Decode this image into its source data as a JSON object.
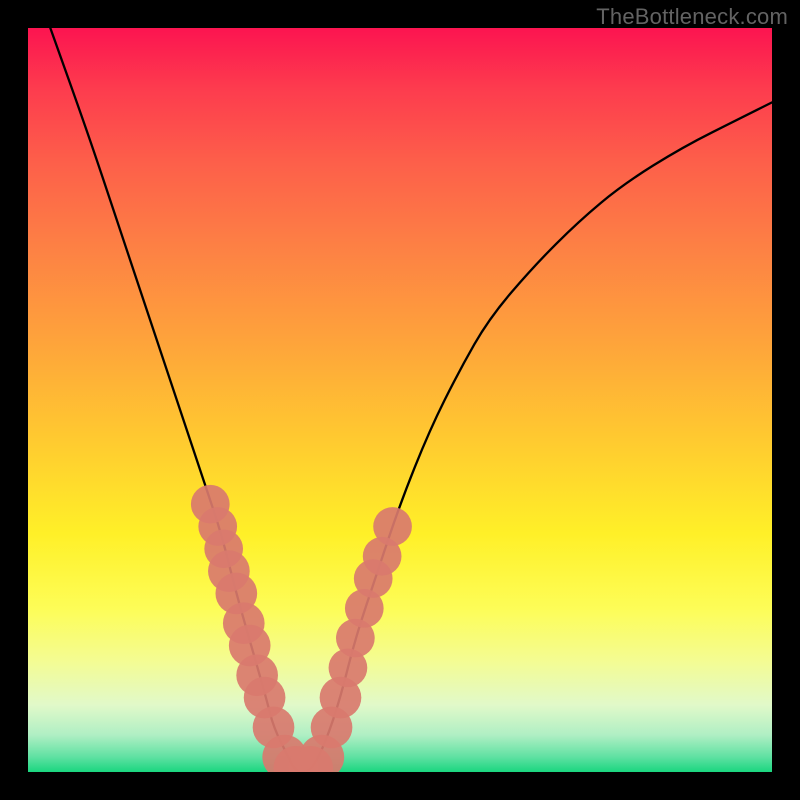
{
  "watermark": "TheBottleneck.com",
  "chart_data": {
    "type": "line",
    "title": "",
    "xlabel": "",
    "ylabel": "",
    "xlim": [
      0,
      100
    ],
    "ylim": [
      0,
      100
    ],
    "grid": false,
    "legend": false,
    "series": [
      {
        "name": "bottleneck-curve",
        "stroke": "#000000",
        "x": [
          3,
          8,
          12,
          16,
          20,
          24,
          26,
          28,
          30,
          32,
          33,
          35,
          36,
          38,
          40,
          42,
          44,
          47,
          50,
          54,
          58,
          62,
          68,
          74,
          80,
          88,
          96,
          100
        ],
        "y": [
          100,
          86,
          74,
          62,
          50,
          38,
          32,
          24,
          17,
          10,
          6,
          2,
          0,
          0,
          4,
          10,
          18,
          27,
          36,
          46,
          54,
          61,
          68,
          74,
          79,
          84,
          88,
          90
        ]
      },
      {
        "name": "marker-dots",
        "type": "scatter",
        "color": "#d97a6e",
        "points": [
          {
            "x": 24.5,
            "y": 36,
            "r": 2.6
          },
          {
            "x": 25.5,
            "y": 33,
            "r": 2.6
          },
          {
            "x": 26.3,
            "y": 30,
            "r": 2.6
          },
          {
            "x": 27.0,
            "y": 27,
            "r": 2.8
          },
          {
            "x": 28.0,
            "y": 24,
            "r": 2.8
          },
          {
            "x": 29.0,
            "y": 20,
            "r": 2.8
          },
          {
            "x": 29.8,
            "y": 17,
            "r": 2.8
          },
          {
            "x": 30.8,
            "y": 13,
            "r": 2.8
          },
          {
            "x": 31.8,
            "y": 10,
            "r": 2.8
          },
          {
            "x": 33.0,
            "y": 6,
            "r": 2.8
          },
          {
            "x": 34.5,
            "y": 2,
            "r": 3.0
          },
          {
            "x": 36.0,
            "y": 0.5,
            "r": 3.0
          },
          {
            "x": 38.0,
            "y": 0.5,
            "r": 3.0
          },
          {
            "x": 39.5,
            "y": 2,
            "r": 3.0
          },
          {
            "x": 40.8,
            "y": 6,
            "r": 2.8
          },
          {
            "x": 42.0,
            "y": 10,
            "r": 2.8
          },
          {
            "x": 43.0,
            "y": 14,
            "r": 2.6
          },
          {
            "x": 44.0,
            "y": 18,
            "r": 2.6
          },
          {
            "x": 45.2,
            "y": 22,
            "r": 2.6
          },
          {
            "x": 46.4,
            "y": 26,
            "r": 2.6
          },
          {
            "x": 47.6,
            "y": 29,
            "r": 2.6
          },
          {
            "x": 49.0,
            "y": 33,
            "r": 2.6
          }
        ]
      }
    ]
  }
}
